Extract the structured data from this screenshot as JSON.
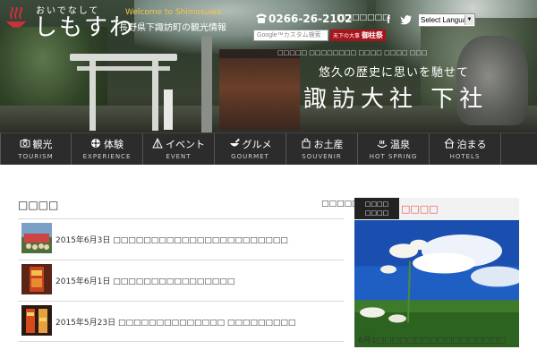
{
  "header": {
    "logo_small": "おいでなして",
    "logo_main": "しもすわ",
    "welcome": "Welcome to Shimosuwa",
    "tagline": "長野県下諏訪町の観光情報",
    "phone": "0266-26-2102",
    "inquiry": "□□□□□□□",
    "language_select": "Select Langua",
    "search_placeholder": "Google™カスタム検索",
    "booking_prefix": "天下の大事",
    "booking_label": "御柱祭",
    "subnav": "□□□□□   □□□□□□□□   □□□□   □□□□   □□□",
    "headline_sub": "悠久の歴史に思いを馳せて",
    "headline": "諏訪大社 下社"
  },
  "nav": [
    {
      "jp": "観光",
      "en": "TOURISM",
      "icon": "camera-icon"
    },
    {
      "jp": "体験",
      "en": "EXPERIENCE",
      "icon": "flower-icon"
    },
    {
      "jp": "イベント",
      "en": "EVENT",
      "icon": "event-icon"
    },
    {
      "jp": "グルメ",
      "en": "GOURMET",
      "icon": "bowl-icon"
    },
    {
      "jp": "お土産",
      "en": "SOUVENIR",
      "icon": "bag-icon"
    },
    {
      "jp": "温泉",
      "en": "HOT SPRING",
      "icon": "onsen-icon"
    },
    {
      "jp": "泊まる",
      "en": "HOTELS",
      "icon": "house-icon"
    }
  ],
  "news": {
    "title": "□□□□",
    "more": "□□□□□",
    "items": [
      {
        "date": "2015年6月3日",
        "text": "□□□□□□□□□□□□□□□□□□□□□□□"
      },
      {
        "date": "2015年6月1日",
        "text": "□□□□□□□□□□□□□□□□"
      },
      {
        "date": "2015年5月23日",
        "text": "□□□□□□□□□□□□□□ □□□□□□□□□"
      }
    ]
  },
  "feature": {
    "label_line1": "□□□□",
    "label_line2": "□□□□",
    "title": "□□□□",
    "caption": "6月1□□□□□□□□□□□□□□□□□"
  },
  "colors": {
    "nav_bg": "#2c2c2c",
    "welcome": "#f2c84b",
    "booking": "#a8141b",
    "feature_title": "#e05b4f"
  }
}
